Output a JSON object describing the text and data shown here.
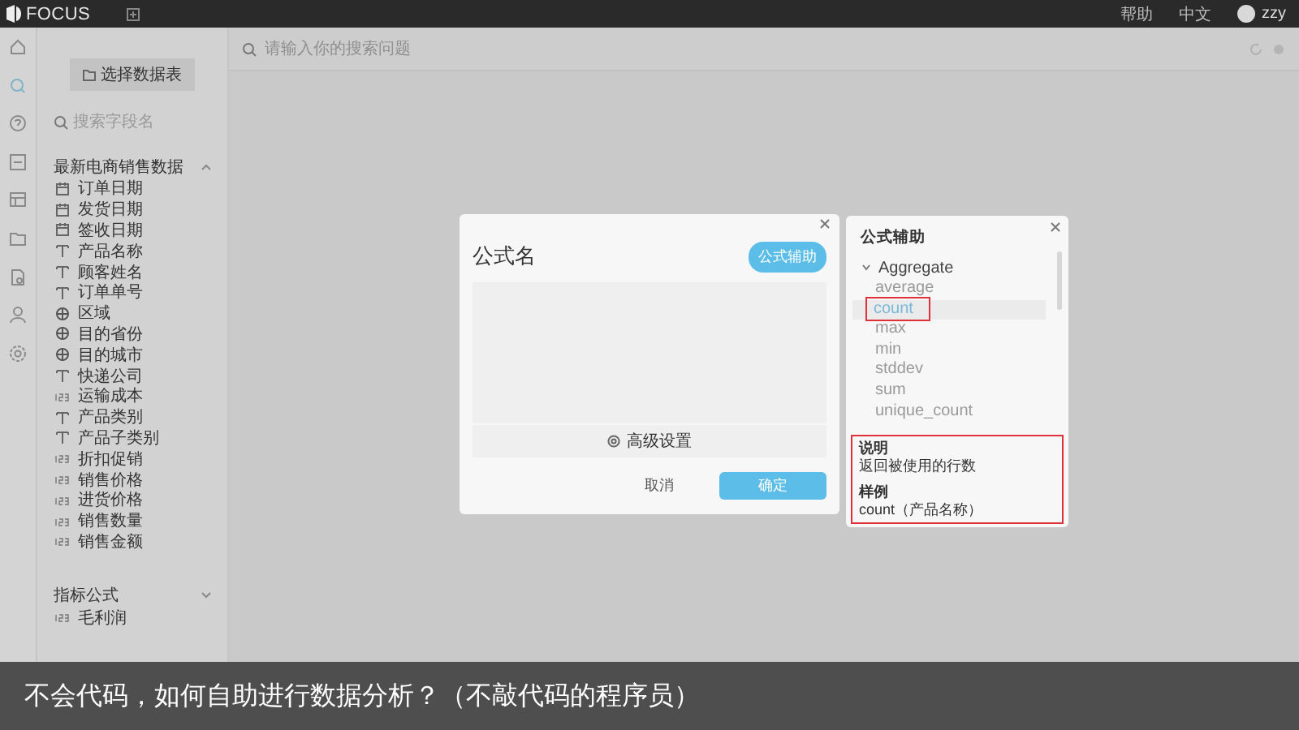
{
  "top_bar": {
    "logo": "FOCUS",
    "links": [
      {
        "label": "帮助"
      },
      {
        "label": "中文"
      }
    ],
    "user": "zzy"
  },
  "rail": [
    {
      "kind": "home",
      "selected": false
    },
    {
      "kind": "search",
      "selected": true
    },
    {
      "kind": "question",
      "selected": false
    },
    {
      "kind": "board",
      "selected": false
    },
    {
      "kind": "table",
      "selected": false
    },
    {
      "kind": "folder",
      "selected": false
    },
    {
      "kind": "file",
      "selected": false
    },
    {
      "kind": "user",
      "selected": false
    },
    {
      "kind": "settings",
      "selected": false
    }
  ],
  "sidebar": {
    "button": "选择数据表",
    "search_placeholder": "搜索字段名",
    "groups": [
      {
        "title": "最新电商销售数据",
        "expanded": true,
        "items": [
          {
            "label": "订单日期",
            "kind": "date"
          },
          {
            "label": "发货日期",
            "kind": "date"
          },
          {
            "label": "签收日期",
            "kind": "date"
          },
          {
            "label": "产品名称",
            "kind": "text"
          },
          {
            "label": "顾客姓名",
            "kind": "text"
          },
          {
            "label": "订单单号",
            "kind": "text"
          },
          {
            "label": "区域",
            "kind": "geo"
          },
          {
            "label": "目的省份",
            "kind": "geo"
          },
          {
            "label": "目的城市",
            "kind": "geo"
          },
          {
            "label": "快递公司",
            "kind": "text"
          },
          {
            "label": "运输成本",
            "kind": "number"
          },
          {
            "label": "产品类别",
            "kind": "text"
          },
          {
            "label": "产品子类别",
            "kind": "text"
          },
          {
            "label": "折扣促销",
            "kind": "number"
          },
          {
            "label": "销售价格",
            "kind": "number"
          },
          {
            "label": "进货价格",
            "kind": "number"
          },
          {
            "label": "销售数量",
            "kind": "number"
          },
          {
            "label": "销售金额",
            "kind": "number"
          }
        ]
      },
      {
        "title": "指标公式",
        "expanded": false,
        "items": [
          {
            "label": "毛利润",
            "kind": "number"
          }
        ]
      }
    ]
  },
  "search": {
    "placeholder": "请输入你的搜索问题"
  },
  "formula_dialog": {
    "title": "公式名",
    "helper_button": "公式辅助",
    "advanced": "高级设置",
    "cancel": "取消",
    "confirm": "确定"
  },
  "helper_panel": {
    "title": "公式辅助",
    "category": {
      "label": "Aggregate",
      "expanded": true
    },
    "functions": [
      {
        "label": "average",
        "selected": false,
        "highlighted": false
      },
      {
        "label": "count",
        "selected": true,
        "highlighted": true
      },
      {
        "label": "max",
        "selected": false,
        "highlighted": false
      },
      {
        "label": "min",
        "selected": false,
        "highlighted": false
      },
      {
        "label": "stddev",
        "selected": false,
        "highlighted": false
      },
      {
        "label": "sum",
        "selected": false,
        "highlighted": false
      },
      {
        "label": "unique_count",
        "selected": false,
        "highlighted": false
      }
    ],
    "details": {
      "heading": "说明",
      "text": "返回被使用的行数",
      "example_heading": "样例",
      "example": "count（产品名称）",
      "highlighted": true
    }
  },
  "subtitle": "不会代码，如何自助进行数据分析？（不敲代码的程序员）"
}
